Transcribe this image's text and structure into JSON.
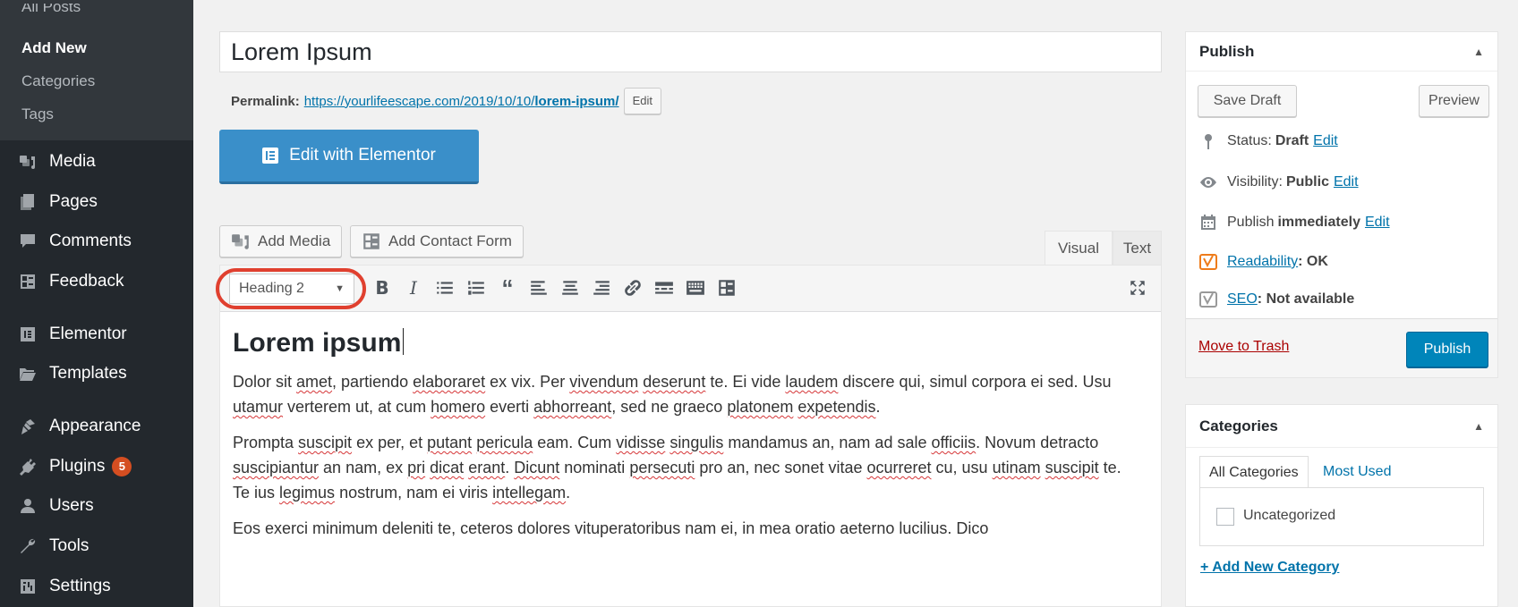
{
  "sidebar": {
    "submenu": [
      {
        "label": "All Posts"
      },
      {
        "label": "Add New"
      },
      {
        "label": "Categories"
      },
      {
        "label": "Tags"
      }
    ],
    "items": [
      {
        "label": "Media",
        "icon": "media-icon"
      },
      {
        "label": "Pages",
        "icon": "pages-icon"
      },
      {
        "label": "Comments",
        "icon": "comments-icon"
      },
      {
        "label": "Feedback",
        "icon": "feedback-icon"
      },
      {
        "label": "Elementor",
        "icon": "elementor-icon"
      },
      {
        "label": "Templates",
        "icon": "templates-icon"
      },
      {
        "label": "Appearance",
        "icon": "appearance-icon"
      },
      {
        "label": "Plugins",
        "icon": "plugins-icon",
        "badge": "5"
      },
      {
        "label": "Users",
        "icon": "users-icon"
      },
      {
        "label": "Tools",
        "icon": "tools-icon"
      },
      {
        "label": "Settings",
        "icon": "settings-icon"
      }
    ]
  },
  "post": {
    "title": "Lorem Ipsum",
    "permalink_label": "Permalink:",
    "permalink_base": "https://yourlifeescape.com/2019/10/10/",
    "permalink_slug": "lorem-ipsum/",
    "permalink_edit": "Edit"
  },
  "elementor": {
    "label": "Edit with Elementor"
  },
  "media_buttons": {
    "add_media": "Add Media",
    "add_contact_form": "Add Contact Form"
  },
  "editor_tabs": {
    "visual": "Visual",
    "text": "Text"
  },
  "toolbar": {
    "format": "Heading 2"
  },
  "content": {
    "heading": "Lorem ipsum",
    "p1": [
      "Dolor sit ",
      {
        "w": "amet"
      },
      ", partiendo ",
      {
        "w": "elaboraret"
      },
      " ex vix. Per ",
      {
        "w": "vivendum"
      },
      " ",
      {
        "w": "deserunt"
      },
      " te. Ei vide ",
      {
        "w": "laudem"
      },
      " discere qui, simul corpora ei sed. Usu ",
      {
        "w": "utamur"
      },
      " verterem ut, at cum ",
      {
        "w": "homero"
      },
      " everti ",
      {
        "w": "abhorreant"
      },
      ", sed ne graeco ",
      {
        "w": "platonem"
      },
      " ",
      {
        "w": "expetendis"
      },
      "."
    ],
    "p2": [
      "Prompta ",
      {
        "w": "suscipit"
      },
      " ex per, et ",
      {
        "w": "putant"
      },
      " ",
      {
        "w": "pericula"
      },
      " eam. Cum ",
      {
        "w": "vidisse"
      },
      " ",
      {
        "w": "singulis"
      },
      " mandamus an, nam ad sale ",
      {
        "w": "officiis"
      },
      ". Novum detracto ",
      {
        "w": "suscipiantur"
      },
      " an nam, ex ",
      {
        "w": "pri"
      },
      " ",
      {
        "w": "dicat"
      },
      " ",
      {
        "w": "erant"
      },
      ". ",
      {
        "w": "Dicunt"
      },
      " nominati ",
      {
        "w": "persecuti"
      },
      " pro an, nec sonet vitae ",
      {
        "w": "ocurreret"
      },
      " cu, usu ",
      {
        "w": "utinam"
      },
      " ",
      {
        "w": "suscipit"
      },
      " te. Te ius ",
      {
        "w": "legimus"
      },
      " nostrum, nam ei viris ",
      {
        "w": "intellegam"
      },
      "."
    ],
    "p3": "Eos exerci minimum deleniti te, ceteros dolores vituperatoribus nam ei, in mea oratio aeterno lucilius. Dico"
  },
  "publish": {
    "title": "Publish",
    "save_draft": "Save Draft",
    "preview": "Preview",
    "status_label": "Status:",
    "status_value": "Draft",
    "visibility_label": "Visibility:",
    "visibility_value": "Public",
    "publish_label": "Publish",
    "publish_value": "immediately",
    "edit": "Edit",
    "readability_label": "Readability",
    "readability_value": ": OK",
    "seo_label": "SEO",
    "seo_value": ": Not available",
    "trash": "Move to Trash",
    "publish_button": "Publish"
  },
  "categories": {
    "title": "Categories",
    "tab_all": "All Categories",
    "tab_used": "Most Used",
    "items": [
      {
        "label": "Uncategorized",
        "checked": false
      }
    ],
    "add_new": "+ Add New Category"
  },
  "colors": {
    "accent": "#0085ba",
    "highlight": "#e0402f",
    "elementor": "#3a8fc9",
    "sidebar": "#23282d"
  }
}
